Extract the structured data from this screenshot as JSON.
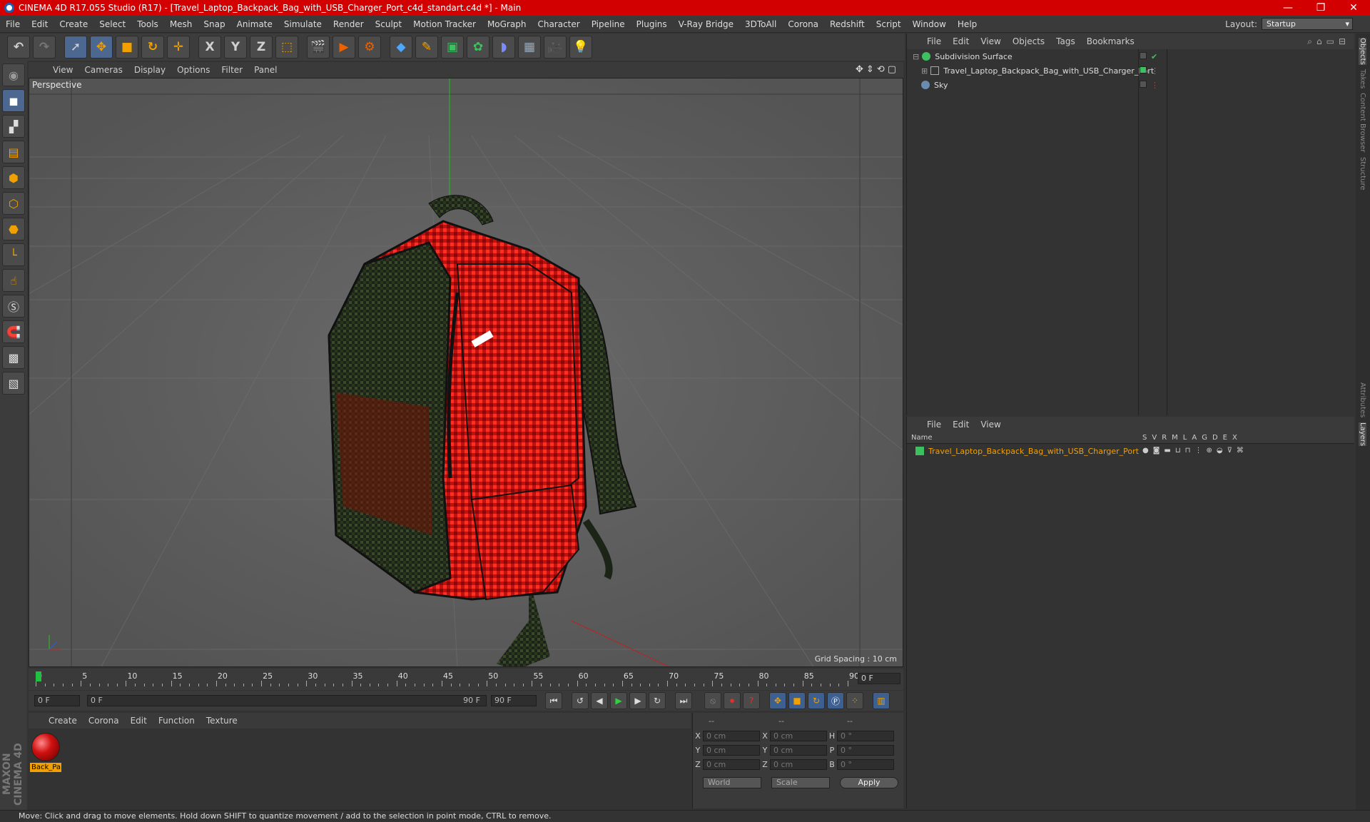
{
  "window": {
    "title": "CINEMA 4D R17.055 Studio (R17) - [Travel_Laptop_Backpack_Bag_with_USB_Charger_Port_c4d_standart.c4d *] - Main",
    "controls": [
      "—",
      "❐",
      "✕"
    ]
  },
  "menubar": {
    "items": [
      "File",
      "Edit",
      "Create",
      "Select",
      "Tools",
      "Mesh",
      "Snap",
      "Animate",
      "Simulate",
      "Render",
      "Sculpt",
      "Motion Tracker",
      "MoGraph",
      "Character",
      "Pipeline",
      "Plugins",
      "V-Ray Bridge",
      "3DToAll",
      "Corona",
      "Redshift",
      "Script",
      "Window",
      "Help"
    ],
    "layout_label": "Layout:",
    "layout_value": "Startup"
  },
  "toolbar": {
    "axis_x": "X",
    "axis_y": "Y",
    "axis_z": "Z"
  },
  "viewport": {
    "menu": [
      "View",
      "Cameras",
      "Display",
      "Options",
      "Filter",
      "Panel"
    ],
    "camera_label": "Perspective",
    "grid_spacing": "Grid Spacing : 10 cm"
  },
  "timeline": {
    "ticks": [
      "0",
      "5",
      "10",
      "15",
      "20",
      "25",
      "30",
      "35",
      "40",
      "45",
      "50",
      "55",
      "60",
      "65",
      "70",
      "75",
      "80",
      "85",
      "90"
    ],
    "current_frame": "0 F",
    "start_field": "0 F",
    "range_start": "0 F",
    "range_end": "90 F",
    "end_field": "90 F"
  },
  "material_manager": {
    "menu": [
      "Create",
      "Corona",
      "Edit",
      "Function",
      "Texture"
    ],
    "material_name": "Back_Pa"
  },
  "coordinates": {
    "header": [
      "--",
      "--",
      "--"
    ],
    "rows": [
      {
        "a1": "X",
        "v1": "0 cm",
        "a2": "X",
        "v2": "0 cm",
        "a3": "H",
        "v3": "0 °"
      },
      {
        "a1": "Y",
        "v1": "0 cm",
        "a2": "Y",
        "v2": "0 cm",
        "a3": "P",
        "v3": "0 °"
      },
      {
        "a1": "Z",
        "v1": "0 cm",
        "a2": "Z",
        "v2": "0 cm",
        "a3": "B",
        "v3": "0 °"
      }
    ],
    "mode": "World",
    "scale": "Scale",
    "apply": "Apply"
  },
  "object_manager": {
    "menu": [
      "File",
      "Edit",
      "View",
      "Objects",
      "Tags",
      "Bookmarks"
    ],
    "objects": [
      {
        "name": "Subdivision Surface",
        "color": "#3cc060"
      },
      {
        "name": "Travel_Laptop_Backpack_Bag_with_USB_Charger_Port",
        "color": "#aaaaaa"
      },
      {
        "name": "Sky",
        "color": "#6a8ab0"
      }
    ]
  },
  "layer_manager": {
    "menu": [
      "File",
      "Edit",
      "View"
    ],
    "name_header": "Name",
    "columns": [
      "S",
      "V",
      "R",
      "M",
      "L",
      "A",
      "G",
      "D",
      "E",
      "X"
    ],
    "layer_name": "Travel_Laptop_Backpack_Bag_with_USB_Charger_Port",
    "layer_color": "#3cc060"
  },
  "right_tabs": [
    "Objects",
    "Takes",
    "Content Browser",
    "Structure",
    "Attributes",
    "Layers"
  ],
  "status": "Move: Click and drag to move elements. Hold down SHIFT to quantize movement / add to the selection in point mode, CTRL to remove.",
  "branding": "MAXON CINEMA 4D",
  "colors": {
    "title_bar": "#d20000",
    "accent": "#f0a000",
    "selected_tool": "#4d6890"
  }
}
